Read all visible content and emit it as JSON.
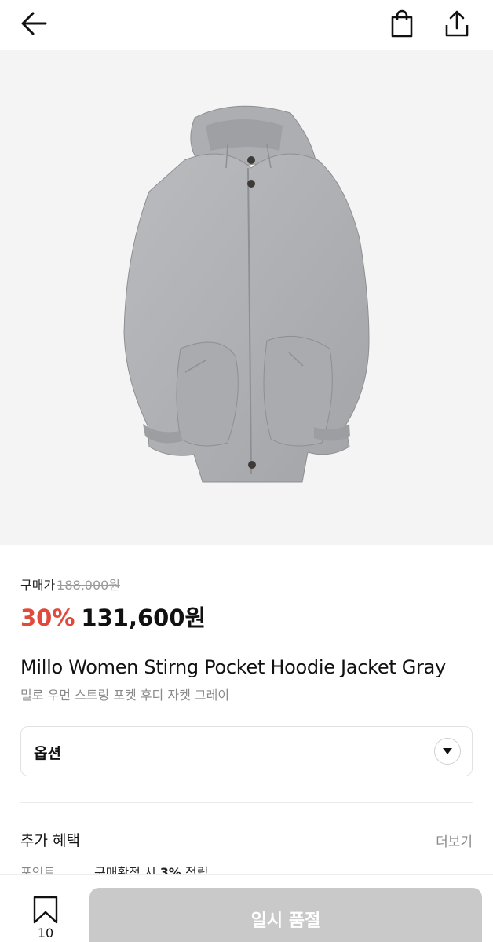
{
  "header": {
    "back_icon": "arrow-left-icon",
    "bag_icon": "shopping-bag-icon",
    "share_icon": "share-icon"
  },
  "product": {
    "image_description_icon": "jacket-image",
    "purchase_label": "구매가",
    "original_price": "188,000원",
    "discount": "30%",
    "sale_price": "131,600원",
    "name_en": "Millo Women Stirng Pocket Hoodie Jacket Gray",
    "name_ko": "밀로 우먼 스트링 포켓 후디 자켓 그레이"
  },
  "option": {
    "label": "옵션",
    "icon": "chevron-down-icon"
  },
  "benefits": {
    "title": "추가 혜택",
    "more": "더보기",
    "rows": [
      {
        "key": "포인트",
        "text_before": "구매확정 시 ",
        "highlight": "3%",
        "text_after": " 적립"
      }
    ]
  },
  "bottom": {
    "wish_count": "10",
    "wish_icon": "bookmark-icon",
    "soldout_label": "일시 품절"
  },
  "colors": {
    "discount": "#e04a3c",
    "soldout_button": "#c9c9c9",
    "hero_bg": "#f4f4f4"
  }
}
